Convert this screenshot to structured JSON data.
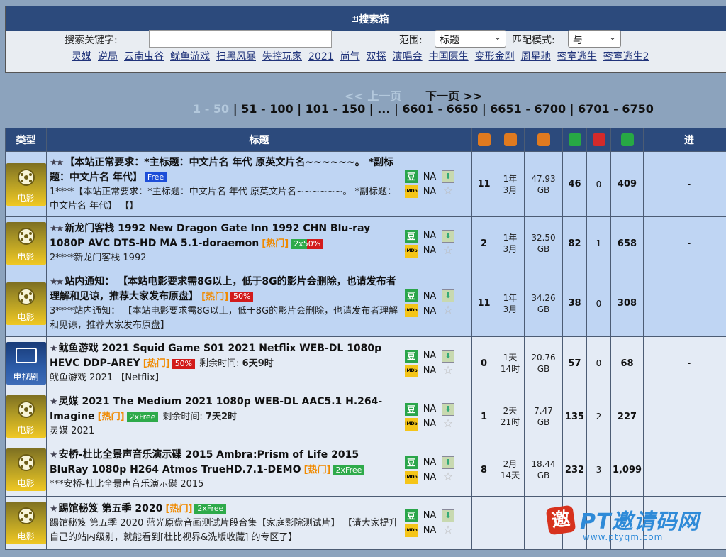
{
  "search": {
    "title": "搜索箱",
    "keyword_label": "搜索关键字:",
    "keyword_value": "",
    "scope_label": "范围:",
    "scope_value": "标题",
    "mode_label": "匹配模式:",
    "mode_value": "与",
    "quick_links": [
      "灵媒",
      "逆局",
      "云南虫谷",
      "鱿鱼游戏",
      "扫黑风暴",
      "失控玩家",
      "2021",
      "尚气",
      "双探",
      "演唱会",
      "中国医生",
      "变形金刚",
      "周星驰",
      "密室逃生",
      "密室逃生2"
    ]
  },
  "pager": {
    "prev_label": "<< 上一页",
    "next_label": "下一页 >>",
    "current": "1 - 50",
    "pages": [
      "51 - 100",
      "101 - 150",
      "...",
      "6601 - 6650",
      "6651 - 6700",
      "6701 - 6750"
    ]
  },
  "table": {
    "headers": {
      "type": "类型",
      "title": "标题",
      "more": "进"
    },
    "header_icon_colors": {
      "comments": "#e07a1f",
      "time": "#e07a1f",
      "size": "#e07a1f",
      "seeders": "#27a844",
      "leechers": "#d42a2a",
      "completed": "#27a844"
    },
    "rows": [
      {
        "type": "电影",
        "type_style": "movie",
        "pinned": true,
        "stars": 2,
        "title": "【本站正常要求：*主标题：中文片名 年代 原英文片名~~~~~~。 *副标题：中文片名 年代】",
        "hot": "",
        "tags": [
          {
            "style": "free",
            "label": "Free"
          }
        ],
        "remain_label": "",
        "remain_value": "",
        "subtitle": "1****【本站正常要求：*主标题：中文片名 年代 原英文片名~~~~~~。 *副标题：中文片名 年代】 【】",
        "douban": "NA",
        "imdb": "NA",
        "comments": "11",
        "time": [
          "1年",
          "3月"
        ],
        "size": [
          "47.93",
          "GB"
        ],
        "seeders": "46",
        "leechers": "0",
        "completed": "409",
        "more": "-"
      },
      {
        "type": "电影",
        "type_style": "movie",
        "pinned": true,
        "stars": 2,
        "title": "新龙门客栈 1992 New Dragon Gate Inn 1992 CHN Blu-ray 1080P AVC DTS-HD MA 5.1-doraemon",
        "hot": "[热门]",
        "tags": [
          {
            "style": "x2half",
            "label": "2x50%"
          }
        ],
        "remain_label": "",
        "remain_value": "",
        "subtitle": "2****新龙门客栈 1992",
        "douban": "NA",
        "imdb": "NA",
        "comments": "2",
        "time": [
          "1年",
          "3月"
        ],
        "size": [
          "32.50",
          "GB"
        ],
        "seeders": "82",
        "leechers": "1",
        "completed": "658",
        "more": "-"
      },
      {
        "type": "电影",
        "type_style": "movie",
        "pinned": true,
        "stars": 2,
        "title": "站内通知： 【本站电影要求需8G以上，低于8G的影片会删除，也请发布者理解和见谅，推荐大家发布原盘】",
        "hot": "[热门]",
        "tags": [
          {
            "style": "half",
            "label": "50%"
          }
        ],
        "remain_label": "",
        "remain_value": "",
        "subtitle": "3****站内通知： 【本站电影要求需8G以上，低于8G的影片会删除，也请发布者理解和见谅，推荐大家发布原盘】",
        "douban": "NA",
        "imdb": "NA",
        "comments": "11",
        "time": [
          "1年",
          "3月"
        ],
        "size": [
          "34.26",
          "GB"
        ],
        "seeders": "38",
        "leechers": "0",
        "completed": "308",
        "more": "-"
      },
      {
        "type": "电视剧",
        "type_style": "tv",
        "pinned": false,
        "stars": 1,
        "title": "鱿鱼游戏 2021 Squid Game S01 2021 Netflix WEB-DL 1080p HEVC DDP-AREY",
        "hot": "[热门]",
        "tags": [
          {
            "style": "half",
            "label": "50%"
          }
        ],
        "remain_label": "剩余时间:",
        "remain_value": "6天9时",
        "subtitle": "鱿鱼游戏 2021 【Netflix】",
        "douban": "NA",
        "imdb": "NA",
        "comments": "0",
        "time": [
          "1天",
          "14时"
        ],
        "size": [
          "20.76",
          "GB"
        ],
        "seeders": "57",
        "leechers": "0",
        "completed": "68",
        "more": "-"
      },
      {
        "type": "电影",
        "type_style": "movie",
        "pinned": false,
        "stars": 1,
        "title": "灵媒 2021 The Medium 2021 1080p WEB-DL AAC5.1 H.264-Imagine",
        "hot": "[热门]",
        "tags": [
          {
            "style": "x2free",
            "label": "2xFree"
          }
        ],
        "remain_label": "剩余时间:",
        "remain_value": "7天2时",
        "subtitle": "灵媒 2021",
        "douban": "NA",
        "imdb": "NA",
        "comments": "1",
        "time": [
          "2天",
          "21时"
        ],
        "size": [
          "7.47",
          "GB"
        ],
        "seeders": "135",
        "leechers": "2",
        "completed": "227",
        "more": "-"
      },
      {
        "type": "电影",
        "type_style": "movie",
        "pinned": false,
        "stars": 1,
        "title": "安桥-杜比全景声音乐演示碟 2015 Ambra:Prism of Life 2015 BluRay 1080p H264 Atmos TrueHD.7.1-DEMO",
        "hot": "[热门]",
        "tags": [
          {
            "style": "x2free",
            "label": "2xFree"
          }
        ],
        "remain_label": "",
        "remain_value": "",
        "subtitle": "***安桥-杜比全景声音乐演示碟 2015",
        "douban": "NA",
        "imdb": "NA",
        "comments": "8",
        "time": [
          "2月",
          "14天"
        ],
        "size": [
          "18.44",
          "GB"
        ],
        "seeders": "232",
        "leechers": "3",
        "completed": "1,099",
        "more": "-"
      },
      {
        "type": "电影",
        "type_style": "movie",
        "pinned": false,
        "stars": 1,
        "title": "踢馆秘笈 第五季 2020",
        "hot": "[热门]",
        "tags": [
          {
            "style": "x2free",
            "label": "2xFree"
          }
        ],
        "remain_label": "",
        "remain_value": "",
        "subtitle": "踢馆秘笈 第五季 2020 蓝光原盘音画测试片段合集【家庭影院测试片】 【请大家提升自己的站内级别，就能看到[杜比视界&洗版收藏] 的专区了】",
        "douban": "NA",
        "imdb": "NA",
        "comments": "",
        "time": [
          "",
          ""
        ],
        "size": [
          "",
          ""
        ],
        "seeders": "",
        "leechers": "",
        "completed": "",
        "more": ""
      }
    ]
  },
  "watermark": {
    "logo": "邀",
    "title": "PT邀请码网",
    "url": "www.ptyqm.com"
  }
}
